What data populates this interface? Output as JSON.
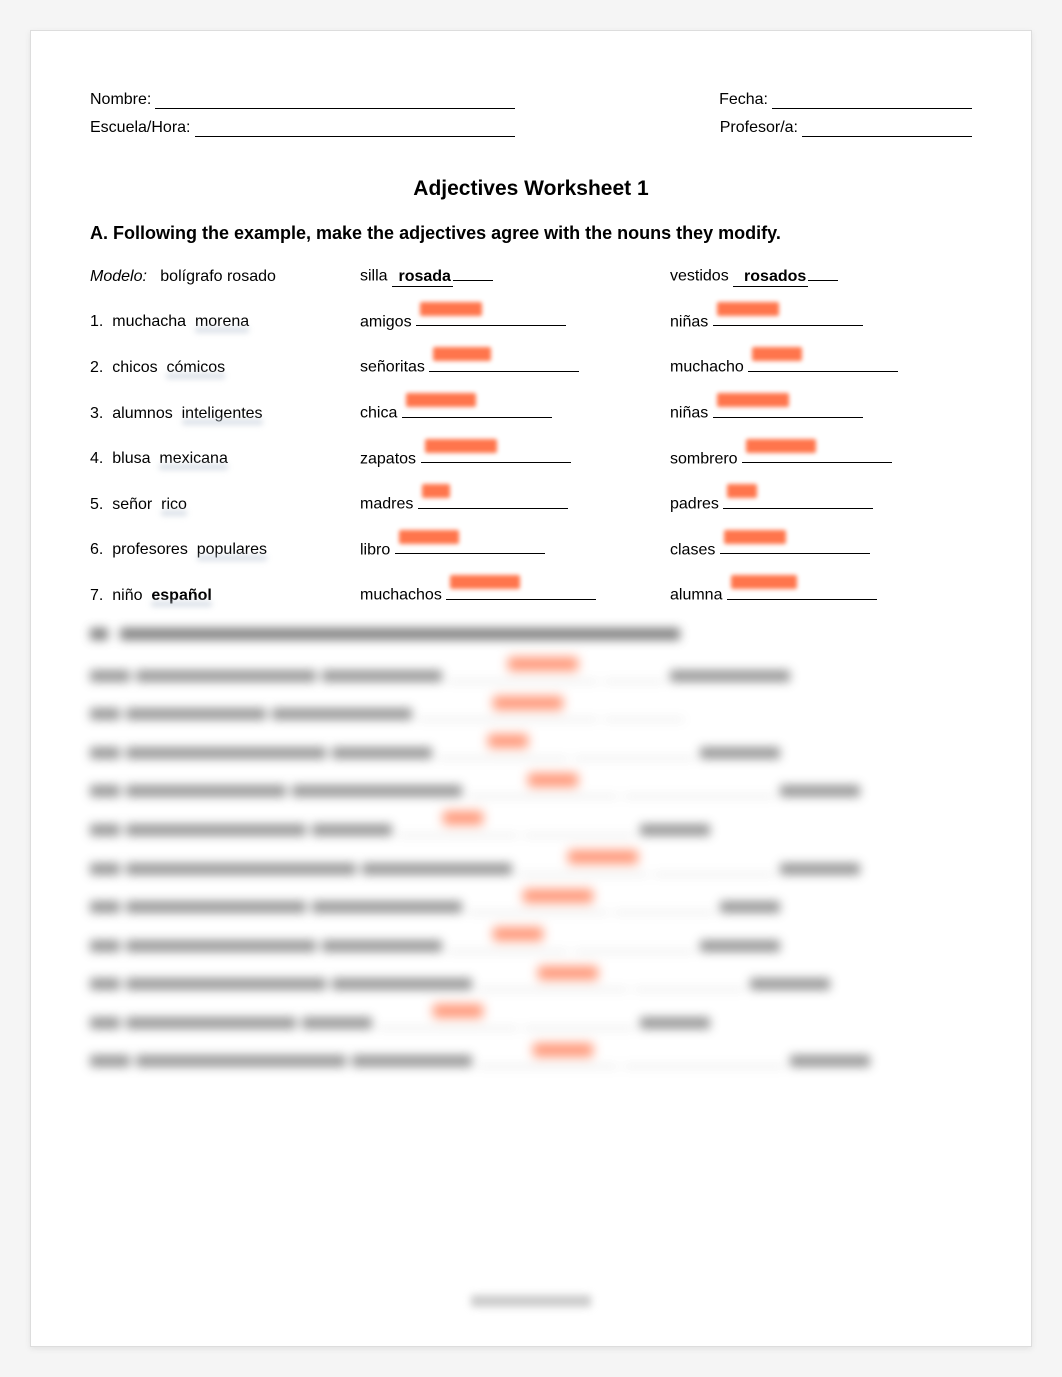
{
  "header": {
    "name_label": "Nombre:",
    "date_label": "Fecha:",
    "school_label": "Escuela/Hora:",
    "teacher_label": "Profesor/a:"
  },
  "title": "Adjectives Worksheet 1",
  "sectionA": {
    "heading": "A. Following the example, make the adjectives agree with the nouns they modify.",
    "model_label": "Modelo:",
    "model_phrase": "bolígrafo rosado",
    "model_col2_noun": "silla",
    "model_col2_answer": "rosada",
    "model_col3_noun": "vestidos",
    "model_col3_answer": "rosados",
    "rows": [
      {
        "num": "1.",
        "noun": "muchacha",
        "adj": "morena",
        "c2": "amigos",
        "c3": "niñas"
      },
      {
        "num": "2.",
        "noun": "chicos",
        "adj": "cómicos",
        "c2": "señoritas",
        "c3": "muchacho"
      },
      {
        "num": "3.",
        "noun": "alumnos",
        "adj": "inteligentes",
        "c2": "chica",
        "c3": "niñas"
      },
      {
        "num": "4.",
        "noun": "blusa",
        "adj": "mexicana",
        "c2": "zapatos",
        "c3": "sombrero"
      },
      {
        "num": "5.",
        "noun": "señor",
        "adj": "rico",
        "c2": "madres",
        "c3": "padres"
      },
      {
        "num": "6.",
        "noun": "profesores",
        "adj": "populares",
        "c2": "libro",
        "c3": "clases"
      },
      {
        "num": "7.",
        "noun": "niño",
        "adj_bold": "español",
        "c2": "muchachos",
        "c3": "alumna"
      }
    ]
  },
  "sectionB": {
    "row_count": 10
  }
}
